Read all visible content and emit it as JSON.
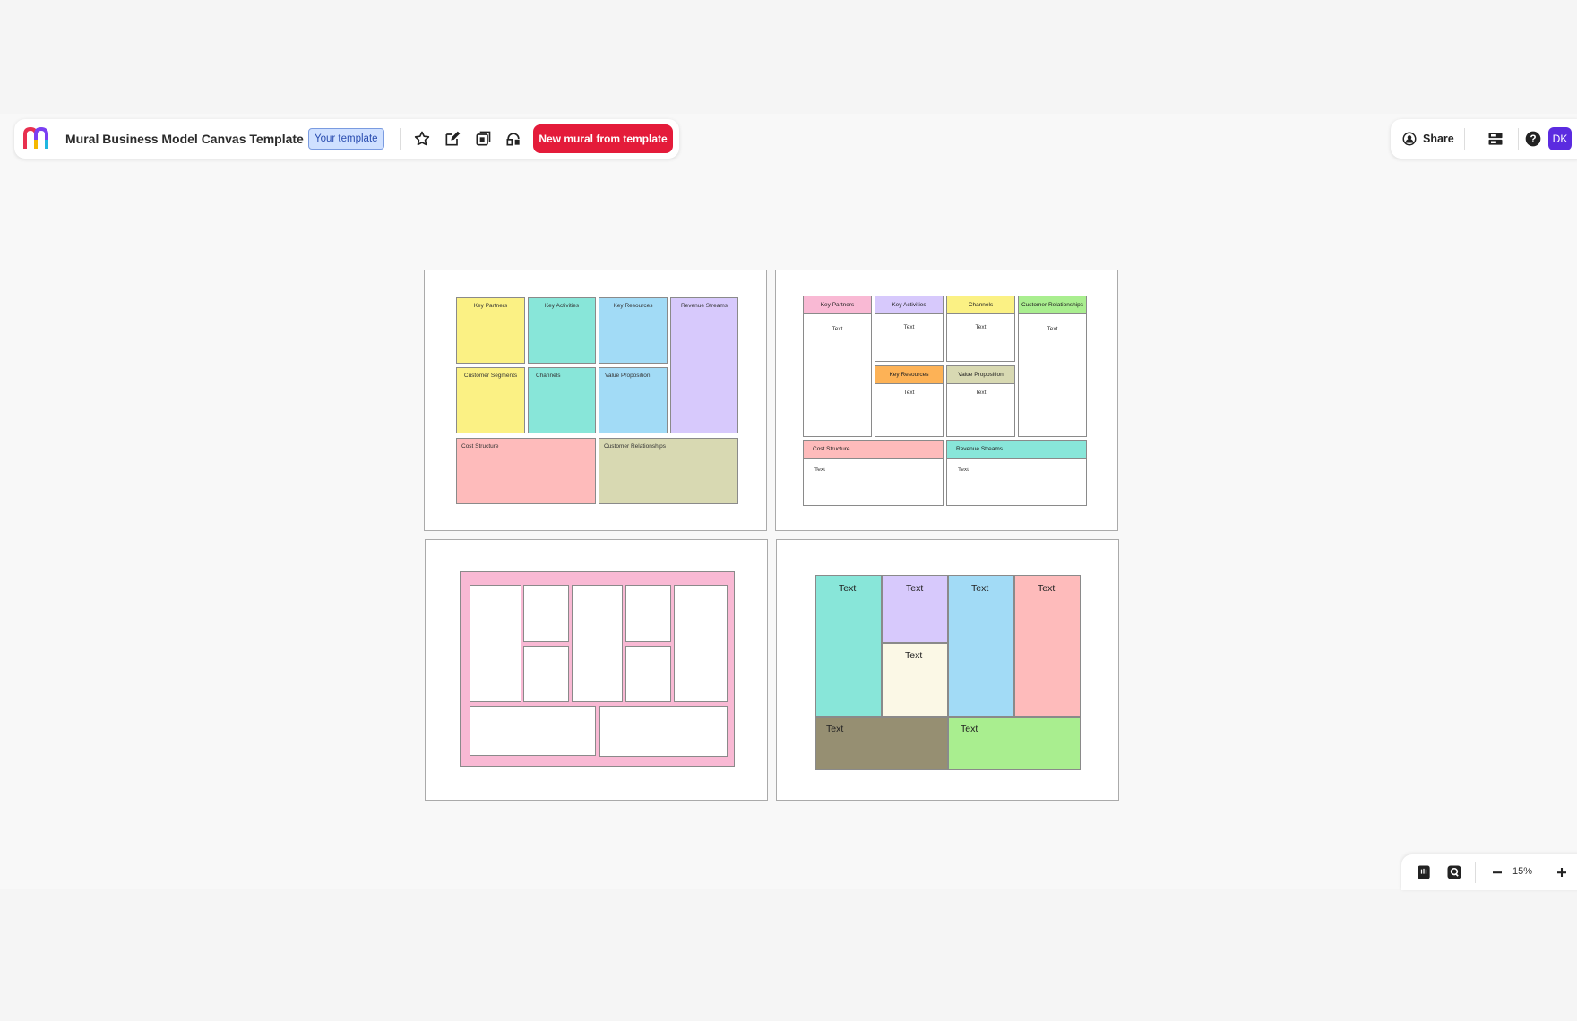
{
  "toolbar": {
    "title": "Mural Business Model Canvas Template",
    "badge": "Your template",
    "new_mural_label": "New mural from template",
    "icons": [
      "star-icon",
      "edit-icon",
      "duplicate-icon",
      "link-icon"
    ]
  },
  "top_right": {
    "share_label": "Share",
    "avatar_initials": "DK"
  },
  "zoom": {
    "level": "15%"
  },
  "colors": {
    "accent": "#e41b3a",
    "avatar": "#5b2be0",
    "yellow": "#fbf184",
    "teal": "#88e6d9",
    "blue": "#a2dbf6",
    "lavender": "#d7c9fc",
    "pink": "#febbbb",
    "khaki": "#d8d9b2"
  },
  "frame1": {
    "key_partners": "Key Partners",
    "key_activities": "Key Activities",
    "key_resources": "Key Resources",
    "revenue_streams": "Revenue Streams",
    "customer_segments": "Customer Segments",
    "channels": "Channels",
    "value_proposition": "Value Proposition",
    "cost_structure": "Cost Structure",
    "customer_relationships": "Customer Relationships"
  },
  "frame2": {
    "key_partners": "Key Partners",
    "key_activities": "Key Activities",
    "channels": "Channels",
    "customer_relationships": "Customer Relationships",
    "key_resources": "Key Resources",
    "value_proposition": "Value Proposition",
    "cost_structure": "Cost Structure",
    "revenue_streams": "Revenue Streams",
    "text": "Text"
  },
  "frame4": {
    "text": "Text"
  }
}
